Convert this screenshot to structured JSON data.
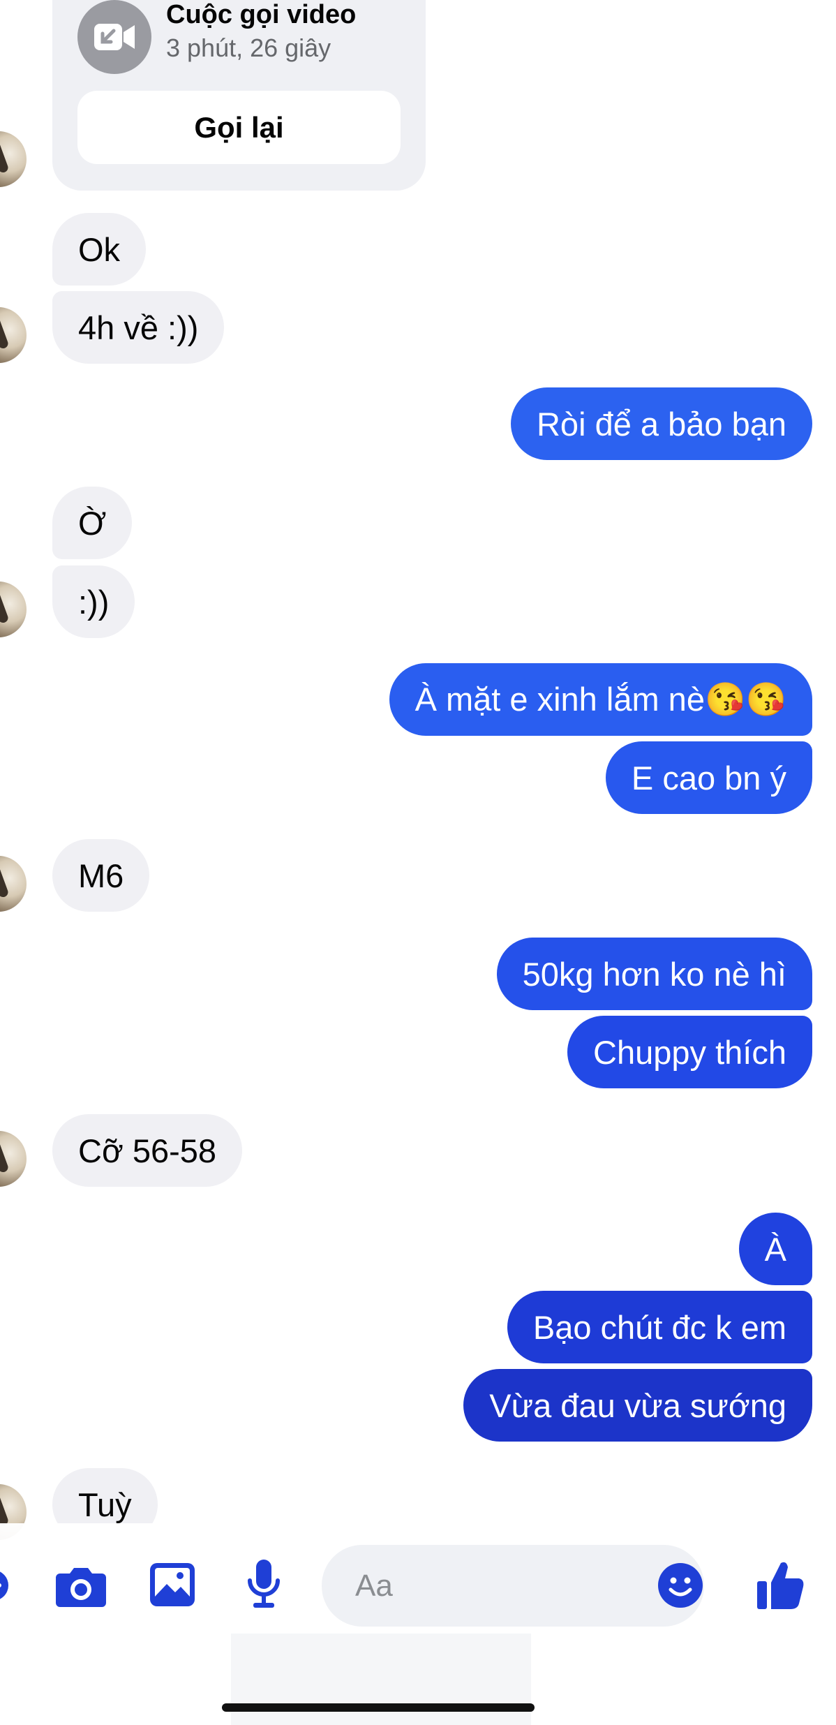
{
  "call": {
    "title": "Cuộc gọi video",
    "duration": "3 phút, 26 giây",
    "callback_label": "Gọi lại"
  },
  "messages": [
    {
      "text": "Ok",
      "from": "them"
    },
    {
      "text": "4h về :))",
      "from": "them"
    },
    {
      "text": "Ròi để a bảo bạn",
      "from": "me"
    },
    {
      "text": "Ờ",
      "from": "them"
    },
    {
      "text": ":))",
      "from": "them"
    },
    {
      "text": "À mặt e xinh lắm nè😘😘",
      "from": "me"
    },
    {
      "text": "E cao bn ý",
      "from": "me"
    },
    {
      "text": "M6",
      "from": "them"
    },
    {
      "text": "50kg hơn ko nè hì",
      "from": "me"
    },
    {
      "text": "Chuppy thích",
      "from": "me"
    },
    {
      "text": "Cỡ 56-58",
      "from": "them"
    },
    {
      "text": "À",
      "from": "me"
    },
    {
      "text": "Bạo chút đc k em",
      "from": "me"
    },
    {
      "text": "Vừa đau vừa sướng",
      "from": "me"
    },
    {
      "text": "Tuỳ",
      "from": "them"
    }
  ],
  "composer": {
    "placeholder": "Aa",
    "icons": [
      "camera-icon",
      "image-icon",
      "microphone-icon",
      "emoji-icon",
      "thumbs-up-icon"
    ]
  },
  "colors": {
    "outgoing_bubble_light": "#2b5ff0",
    "outgoing_bubble_dark": "#1d34c8",
    "incoming_bubble": "#f0f0f4",
    "icon_blue": "#1f3fd6"
  }
}
